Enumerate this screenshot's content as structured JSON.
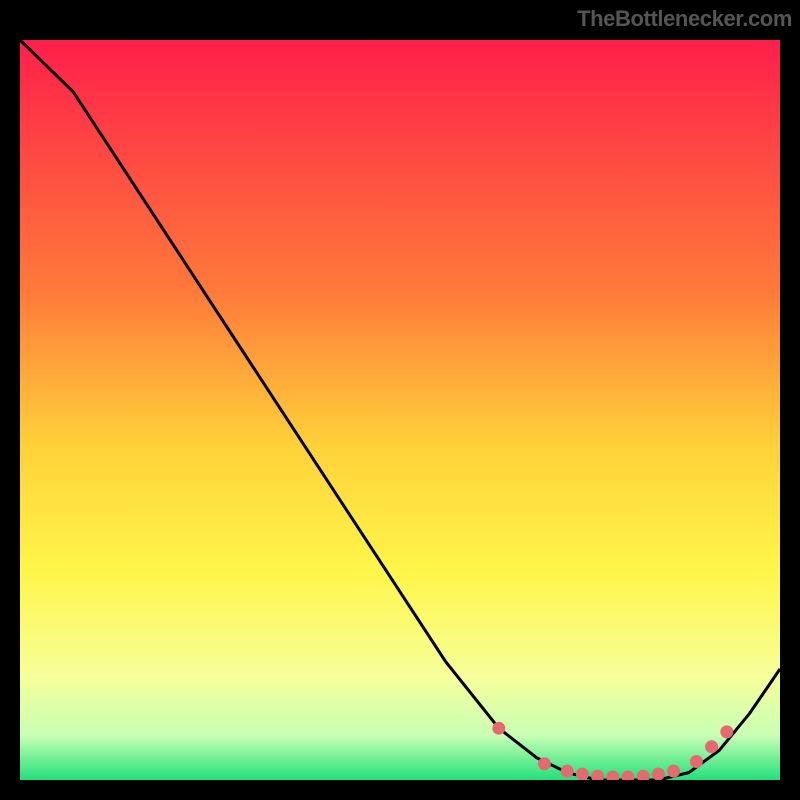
{
  "credit": "TheBottlenecker.com",
  "colors": {
    "bg": "#000000",
    "curve": "#000000",
    "dot": "#e56a6f",
    "credit_text": "#565656"
  },
  "chart_data": {
    "type": "line",
    "title": "",
    "xlabel": "",
    "ylabel": "",
    "xlim": [
      0,
      100
    ],
    "ylim": [
      0,
      100
    ],
    "gradient_stops": [
      {
        "pct": 0,
        "color": "#ff1f4b"
      },
      {
        "pct": 34,
        "color": "#ff7a3a"
      },
      {
        "pct": 55,
        "color": "#ffd23a"
      },
      {
        "pct": 72,
        "color": "#fff64a"
      },
      {
        "pct": 86,
        "color": "#f6ff9a"
      },
      {
        "pct": 94,
        "color": "#c8ffb4"
      },
      {
        "pct": 100,
        "color": "#22e07a"
      }
    ],
    "series": [
      {
        "name": "bottleneck-curve",
        "x": [
          0,
          7,
          14,
          21,
          28,
          35,
          42,
          49,
          56,
          63,
          68,
          72,
          76,
          80,
          84,
          88,
          92,
          96,
          100
        ],
        "y": [
          100,
          93,
          82,
          71,
          60,
          49,
          38,
          27,
          16,
          7,
          3,
          1,
          0,
          0,
          0,
          1,
          4,
          9,
          15
        ]
      }
    ],
    "markers": {
      "name": "highlight-dots",
      "x": [
        63,
        69,
        72,
        74,
        76,
        78,
        80,
        82,
        84,
        86,
        89,
        91,
        93
      ],
      "y": [
        7,
        2.2,
        1.2,
        0.8,
        0.5,
        0.4,
        0.4,
        0.5,
        0.8,
        1.2,
        2.5,
        4.5,
        6.5
      ]
    }
  }
}
